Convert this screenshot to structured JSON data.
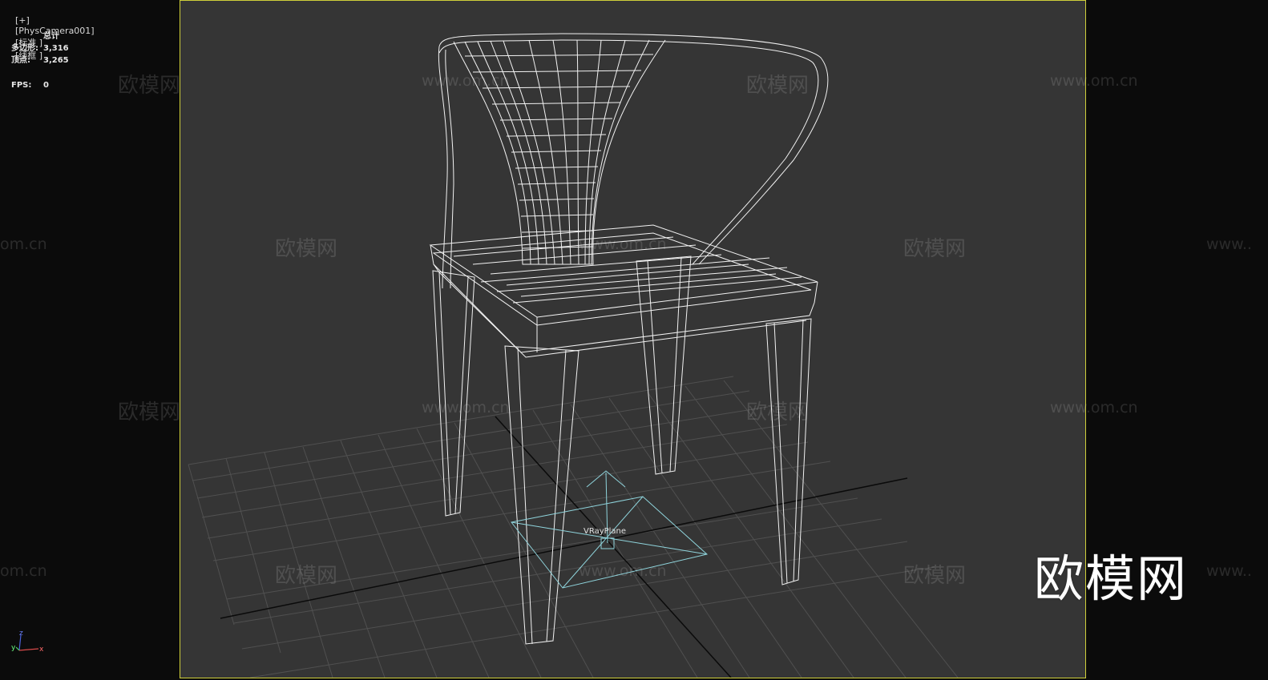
{
  "viewport": {
    "label_parts": [
      "[+]",
      "[PhysCamera001]",
      "[标准 ]",
      "[线框 ]"
    ]
  },
  "stats": {
    "total_label": "总计",
    "polys_label": "多边形:",
    "polys_value": "3,316",
    "verts_label": "顶点:",
    "verts_value": "3,265",
    "fps_label": "FPS:",
    "fps_value": "0"
  },
  "object_label": "VRayPlane",
  "axis_labels": {
    "z": "z",
    "x": "x",
    "y": "y"
  },
  "watermark": {
    "cn": "欧模网",
    "url": "www.om.cn",
    "url_partial": "om.cn",
    "url_partial_right": "www..",
    "logo": "欧模网"
  },
  "colors": {
    "frame_border": "#cfcf3a",
    "viewport_bg": "#353535",
    "wire": "#f2f2f2",
    "light_wire": "#8fd4dc"
  }
}
